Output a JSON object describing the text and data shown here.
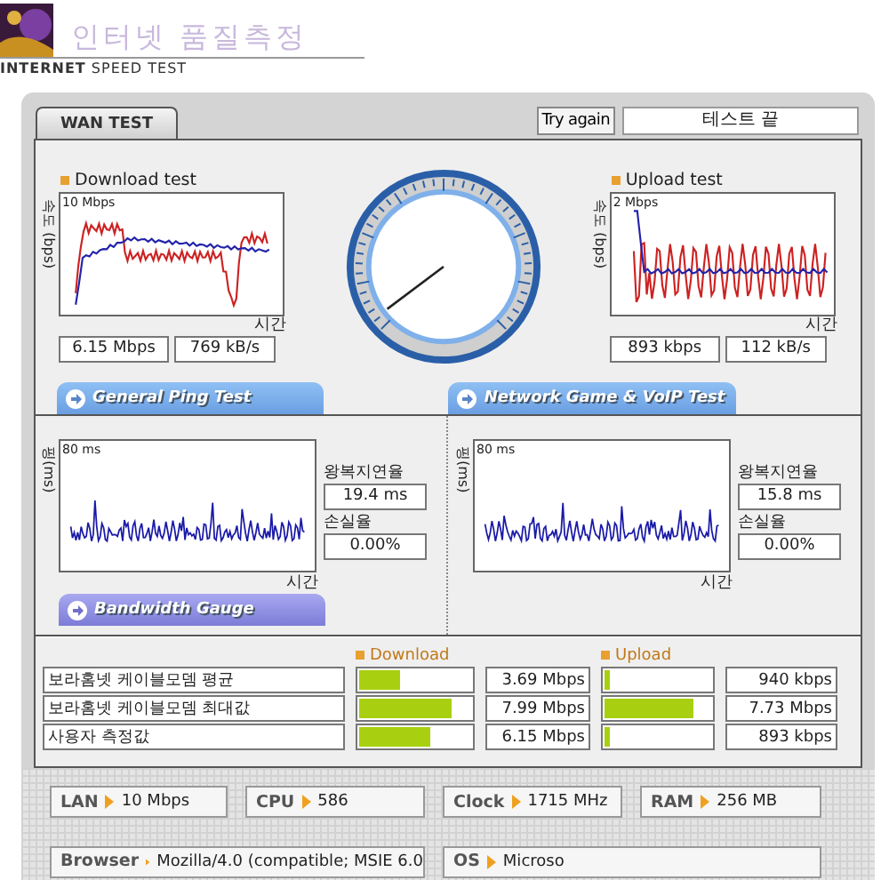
{
  "header": {
    "logo_text": "인터넷 품질측정",
    "subtitle_bold": "INTERNET",
    "subtitle": "SPEED TEST"
  },
  "tabs": [
    {
      "label": "WAN TEST",
      "selected": true
    }
  ],
  "try_again": "Try again",
  "status": "테스트 끝",
  "speed_tests": [
    {
      "kind": "download",
      "title": "Download test",
      "axis_label": "속도 (bps)",
      "scale": "10 Mbps",
      "x_label": "시간",
      "readings": [
        "6.15 Mbps",
        "769 kB/s"
      ]
    },
    {
      "kind": "upload",
      "title": "Upload test",
      "axis_label": "속도 (bps)",
      "scale": "2 Mbps",
      "x_label": "시간",
      "readings": [
        "893 kbps",
        "112 kB/s"
      ]
    }
  ],
  "section_heads": [
    {
      "kind": "ping",
      "label": "General Ping Test"
    },
    {
      "kind": "ping",
      "label": "Network Game & VoIP Test"
    }
  ],
  "ping_tests": [
    {
      "axis_label": "핑(ms)",
      "scale": "80 ms",
      "x_label": "시간",
      "latency_label": "왕복지연율",
      "latency": "19.4 ms",
      "loss_label": "손실율",
      "loss": "0.00%"
    },
    {
      "axis_label": "핑(ms)",
      "scale": "80 ms",
      "x_label": "시간",
      "latency_label": "왕복지연율",
      "latency": "15.8 ms",
      "loss_label": "손실율",
      "loss": "0.00%"
    }
  ],
  "bandwidth": {
    "heading": {
      "kind": "gauge",
      "label": "Bandwidth Gauge"
    },
    "columns": [
      "Download",
      "Upload"
    ],
    "rows": [
      {
        "label": "보라홈넷 케이블모뎀 평균",
        "download": {
          "level": 0.37,
          "reading": "3.69 Mbps"
        },
        "upload": {
          "level": 0.05,
          "reading": "940 kbps"
        }
      },
      {
        "label": "보라홈넷 케이블모뎀 최대값",
        "download": {
          "level": 0.83,
          "reading": "7.99 Mbps"
        },
        "upload": {
          "level": 0.83,
          "reading": "7.73 Mbps"
        }
      },
      {
        "label": "사용자 측정값",
        "download": {
          "level": 0.63,
          "reading": "6.15 Mbps"
        },
        "upload": {
          "level": 0.05,
          "reading": "893 kbps"
        }
      }
    ]
  },
  "system": [
    {
      "label": "LAN",
      "value": "10 Mbps"
    },
    {
      "label": "CPU",
      "value": "586"
    },
    {
      "label": "Clock",
      "value": "1715 MHz"
    },
    {
      "label": "RAM",
      "value": "256 MB"
    },
    {
      "label": "Browser",
      "value": "Mozilla/4.0 (compatible; MSIE 6.0"
    },
    {
      "label": "OS",
      "value": "Microso"
    }
  ]
}
